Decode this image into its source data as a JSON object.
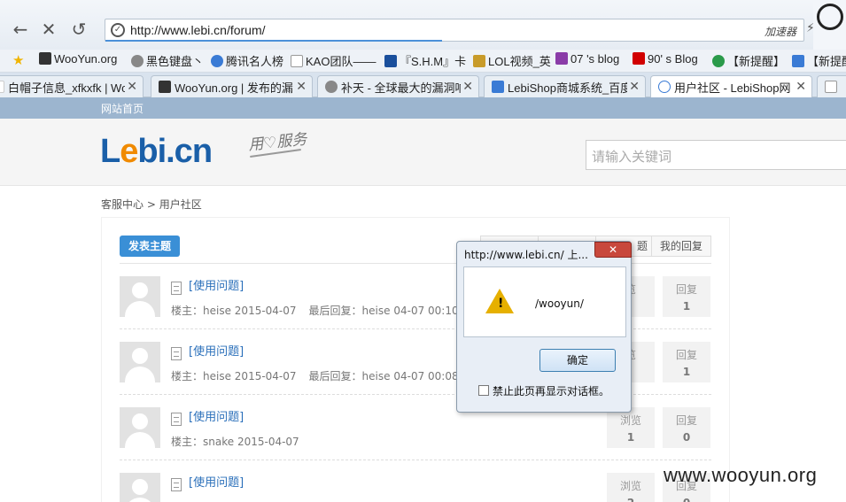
{
  "browser": {
    "url": "http://www.lebi.cn/forum/",
    "accelerator": "加速器",
    "bookmarks": [
      {
        "label": "WooYun.org",
        "color": "#333"
      },
      {
        "label": "黑色键盘丶",
        "color": "#888"
      },
      {
        "label": "腾讯名人榜",
        "color": "#3a7bd5"
      },
      {
        "label": "KAO团队——",
        "color": "#999"
      },
      {
        "label": "『S.H.M』卡",
        "color": "#1a4f9c"
      },
      {
        "label": "LOL视频_英",
        "color": "#c89b2a"
      },
      {
        "label": "07 's blog",
        "color": "#8a3ca8"
      },
      {
        "label": "90' s Blog",
        "color": "#d10000"
      },
      {
        "label": "【新提醒】",
        "color": "#2a9a4a"
      },
      {
        "label": "【新提醒】",
        "color": "#3a7bd5"
      }
    ],
    "tabs": [
      {
        "label": "白帽子信息_xfkxfk | Wo"
      },
      {
        "label": "WooYun.org | 发布的漏"
      },
      {
        "label": "补天 - 全球最大的漏洞响"
      },
      {
        "label": "LebiShop商城系统_百度"
      },
      {
        "label": "用户社区 - LebiShop网"
      }
    ]
  },
  "site": {
    "home_link": "网站首页",
    "logo_main": "L",
    "logo_e": "e",
    "logo_rest": "bi.cn",
    "slogan": "用♡服务",
    "search_placeholder": "请输入关键词"
  },
  "breadcrumb": {
    "a": "客服中心",
    "sep": " > ",
    "b": "用户社区"
  },
  "forum": {
    "post_button": "发表主题",
    "filter_tabs": [
      "",
      "",
      "题",
      "我的回复"
    ],
    "posts": [
      {
        "title": "[使用问题]",
        "author": "楼主：heise",
        "date": "2015-04-07",
        "last": "最后回复：heise",
        "last_time": "04-07 00:10",
        "views_label": "览",
        "views": "",
        "replies_label": "回复",
        "replies": "1"
      },
      {
        "title": "[使用问题]",
        "author": "楼主：heise",
        "date": "2015-04-07",
        "last": "最后回复：heise",
        "last_time": "04-07 00:08",
        "views_label": "览",
        "views": "",
        "replies_label": "回复",
        "replies": "1"
      },
      {
        "title": "[使用问题]",
        "author": "楼主：snake",
        "date": "2015-04-07",
        "last": "",
        "last_time": "",
        "views_label": "浏览",
        "views": "1",
        "replies_label": "回复",
        "replies": "0"
      },
      {
        "title": "[使用问题]",
        "author": "",
        "date": "",
        "last": "",
        "last_time": "",
        "views_label": "浏览",
        "views": "2",
        "replies_label": "回复",
        "replies": "0"
      }
    ]
  },
  "dialog": {
    "title": "http://www.lebi.cn/ 上...",
    "message": "/wooyun/",
    "ok": "确定",
    "checkbox_label": "禁止此页再显示对话框。",
    "close": "✕"
  },
  "watermark": "www.wooyun.org"
}
